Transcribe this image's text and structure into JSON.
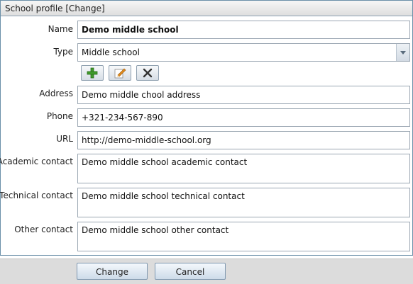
{
  "window": {
    "title": "School profile [Change]"
  },
  "form": {
    "name": {
      "label": "Name",
      "value": "Demo middle school"
    },
    "type": {
      "label": "Type",
      "value": "Middle school"
    },
    "address": {
      "label": "Address",
      "value": "Demo middle chool address"
    },
    "phone": {
      "label": "Phone",
      "value": "+321-234-567-890"
    },
    "url": {
      "label": "URL",
      "value": "http://demo-middle-school.org"
    },
    "academic_contact": {
      "label": "Academic contact",
      "value": "Demo middle school  academic contact"
    },
    "technical_contact": {
      "label": "Technical contact",
      "value": "Demo middle school  technical contact"
    },
    "other_contact": {
      "label": "Other contact",
      "value": "Demo middle school  other contact"
    }
  },
  "type_toolbar": {
    "icons": [
      "add-icon",
      "edit-icon",
      "delete-icon"
    ],
    "colors": {
      "add": "#3f9a2b",
      "edit": "#e08a1c",
      "delete": "#333333"
    }
  },
  "footer": {
    "change_label": "Change",
    "cancel_label": "Cancel"
  }
}
